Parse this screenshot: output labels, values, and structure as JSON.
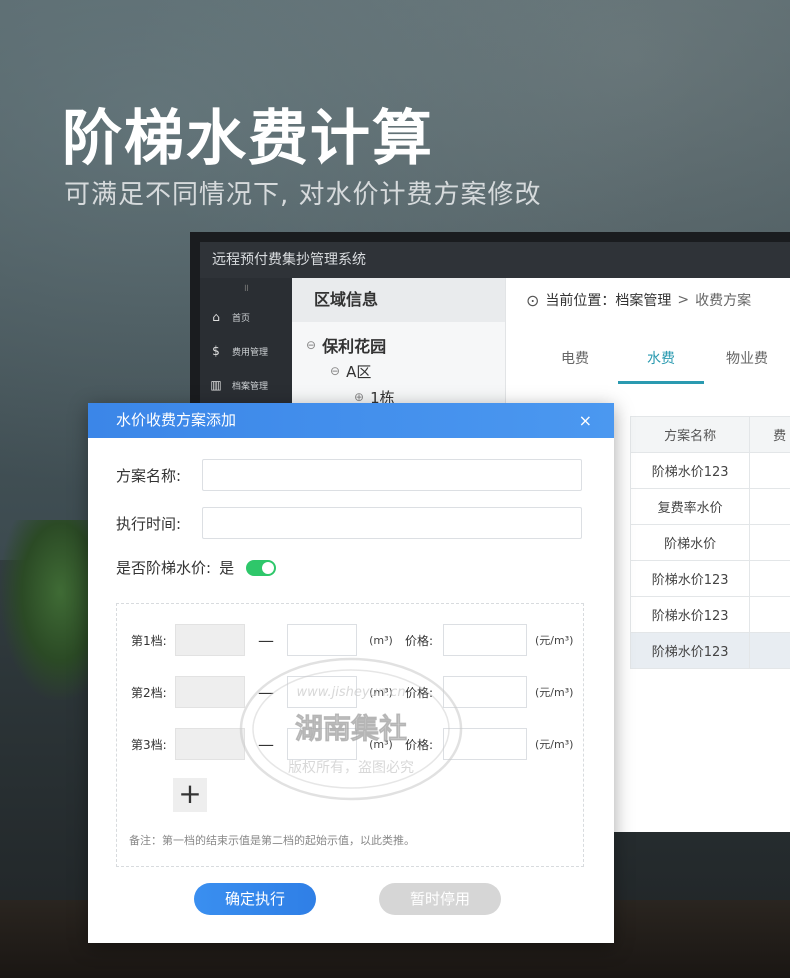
{
  "hero": {
    "title": "阶梯水费计算",
    "subtitle": "可满足不同情况下, 对水价计费方案修改"
  },
  "system": {
    "title": "远程预付费集抄管理系统",
    "collapse_glyph": "॥",
    "sidebar": [
      {
        "label": "首页",
        "icon": "home-icon"
      },
      {
        "label": "费用管理",
        "icon": "dollar-icon"
      },
      {
        "label": "档案管理",
        "icon": "archive-icon"
      }
    ],
    "area": {
      "header": "区域信息",
      "tree": [
        "保利花园",
        "A区",
        "1栋"
      ]
    },
    "breadcrumb": {
      "prefix": "当前位置：档案管理",
      "separator": ">",
      "current": "收费方案"
    },
    "tabs": [
      {
        "label": "电费",
        "active": false
      },
      {
        "label": "水费",
        "active": true
      },
      {
        "label": "物业费",
        "active": false
      }
    ],
    "table": {
      "headers": [
        "方案名称",
        "费"
      ],
      "rows": [
        "阶梯水价123",
        "复费率水价",
        "阶梯水价",
        "阶梯水价123",
        "阶梯水价123",
        "阶梯水价123"
      ]
    }
  },
  "dialog": {
    "title": "水价收费方案添加",
    "close_glyph": "×",
    "plan_name_label": "方案名称:",
    "plan_name_value": "",
    "exec_time_label": "执行时间:",
    "exec_time_value": "",
    "tiered_label": "是否阶梯水价:",
    "tiered_value": "是",
    "tiered_on": true,
    "tiers": [
      {
        "label": "第1档:",
        "dash": "—",
        "unit": "(m³)",
        "price_label": "价格:",
        "price_unit": "(元/m³)"
      },
      {
        "label": "第2档:",
        "dash": "—",
        "unit": "(m³)",
        "price_label": "价格:",
        "price_unit": "(元/m³)"
      },
      {
        "label": "第3档:",
        "dash": "—",
        "unit": "(m³)",
        "price_label": "价格:",
        "price_unit": "(元/m³)"
      }
    ],
    "add_glyph": "+",
    "note": "备注：第一档的结束示值是第二档的起始示值，以此类推。",
    "confirm_label": "确定执行",
    "pause_label": "暂时停用"
  },
  "watermark": {
    "url": "www.jisheyun.cn",
    "name": "湖南集社",
    "rights": "版权所有，盗图必究"
  },
  "colors": {
    "accent": "#3b86e8",
    "tab_active": "#2a9ab0",
    "toggle_on": "#2ec76a"
  }
}
